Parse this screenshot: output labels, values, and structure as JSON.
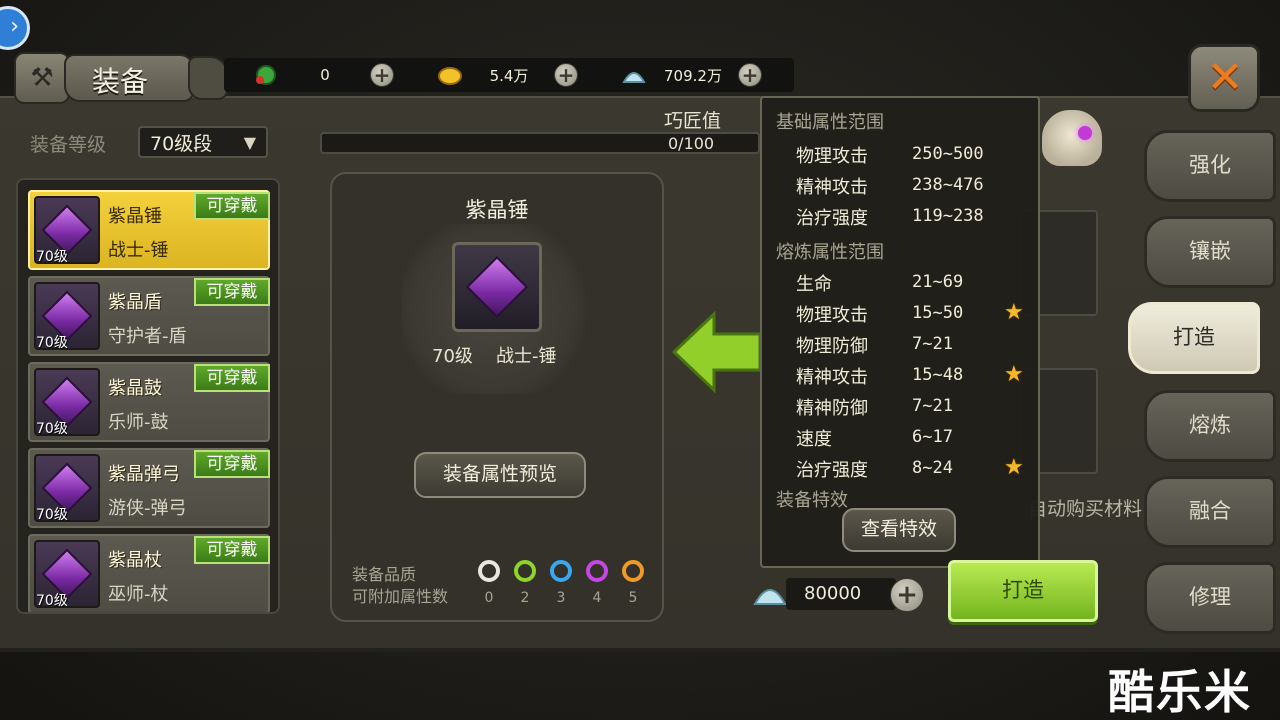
{
  "header": {
    "title": "装备",
    "currency": [
      {
        "icon": "green-gem-icon",
        "value": "0"
      },
      {
        "icon": "gold-icon",
        "value": "5.4万"
      },
      {
        "icon": "shell-icon",
        "value": "709.2万"
      }
    ]
  },
  "filter": {
    "label": "装备等级",
    "value": "70级段"
  },
  "list": [
    {
      "name": "紫晶锤",
      "cls": "战士-锤",
      "level": "70级",
      "tag": "可穿戴"
    },
    {
      "name": "紫晶盾",
      "cls": "守护者-盾",
      "level": "70级",
      "tag": "可穿戴"
    },
    {
      "name": "紫晶鼓",
      "cls": "乐师-鼓",
      "level": "70级",
      "tag": "可穿戴"
    },
    {
      "name": "紫晶弹弓",
      "cls": "游侠-弹弓",
      "level": "70级",
      "tag": "可穿戴"
    },
    {
      "name": "紫晶杖",
      "cls": "巫师-杖",
      "level": "70级",
      "tag": "可穿戴"
    }
  ],
  "craft": {
    "label": "巧匠值",
    "value": "0/100",
    "progress": 0
  },
  "card": {
    "title": "紫晶锤",
    "level": "70级",
    "cls": "战士-锤",
    "preview_btn": "装备属性预览",
    "quality_label": "装备品质",
    "attr_label": "可附加属性数",
    "quality": [
      {
        "color": "#e8e6de",
        "num": "0"
      },
      {
        "color": "#8ed42a",
        "num": "2"
      },
      {
        "color": "#3aa8ee",
        "num": "3"
      },
      {
        "color": "#c648e4",
        "num": "4"
      },
      {
        "color": "#f09a26",
        "num": "5"
      }
    ]
  },
  "tooltip": {
    "base_head": "基础属性范围",
    "base": [
      {
        "k": "物理攻击",
        "v": "250~500"
      },
      {
        "k": "精神攻击",
        "v": "238~476"
      },
      {
        "k": "治疗强度",
        "v": "119~238"
      }
    ],
    "smelt_head": "熔炼属性范围",
    "smelt": [
      {
        "k": "生命",
        "v": "21~69",
        "star": false
      },
      {
        "k": "物理攻击",
        "v": "15~50",
        "star": true
      },
      {
        "k": "物理防御",
        "v": "7~21",
        "star": false
      },
      {
        "k": "精神攻击",
        "v": "15~48",
        "star": true
      },
      {
        "k": "精神防御",
        "v": "7~21",
        "star": false
      },
      {
        "k": "速度",
        "v": "6~17",
        "star": false
      },
      {
        "k": "治疗强度",
        "v": "8~24",
        "star": true
      }
    ],
    "fx_head": "装备特效",
    "fx_btn": "查看特效"
  },
  "auto_buy": "自动购买材料",
  "cost": "80000",
  "forge_btn": "打造",
  "tabs": [
    {
      "label": "强化",
      "active": false
    },
    {
      "label": "镶嵌",
      "active": false
    },
    {
      "label": "打造",
      "active": true
    },
    {
      "label": "熔炼",
      "active": false
    },
    {
      "label": "融合",
      "active": false
    },
    {
      "label": "修理",
      "active": false
    }
  ],
  "watermark": "酷乐米",
  "colors": {
    "accent_green": "#8fcf2c",
    "selected_gold": "#f0cd34",
    "close_orange": "#f07a1e"
  }
}
